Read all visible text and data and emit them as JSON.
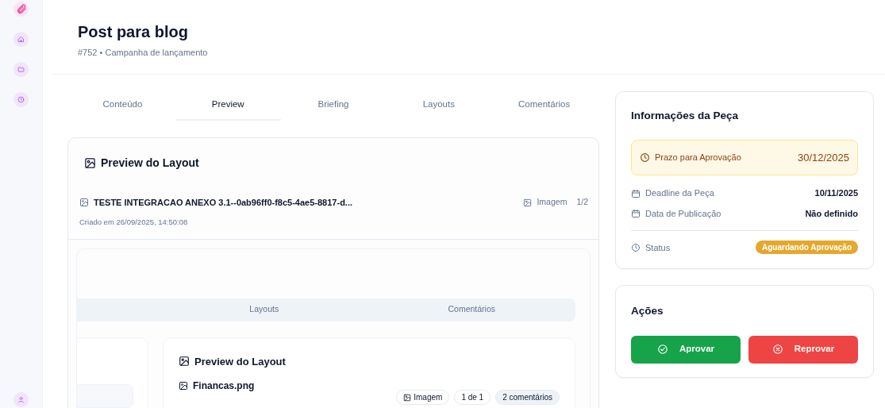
{
  "header": {
    "title": "Post para blog",
    "subtitle": "#752 • Campanha de lançamento"
  },
  "tabs": [
    {
      "label": "Conteúdo",
      "selected": false
    },
    {
      "label": "Preview",
      "selected": true
    },
    {
      "label": "Briefing",
      "selected": false
    },
    {
      "label": "Layouts",
      "selected": false
    },
    {
      "label": "Comentários",
      "selected": false
    }
  ],
  "preview": {
    "title": "Preview do Layout",
    "file_name": "TESTE INTEGRACAO ANEXO 3.1--0ab96ff0-f8c5-4ae5-8817-d...",
    "file_type": "Imagem",
    "page": "1/2",
    "created": "Criado em 26/09/2025, 14:50:08",
    "embedded": {
      "tabs": [
        "Layouts",
        "Comentários"
      ],
      "card_title": "Preview do Layout",
      "file_name": "Financas.png",
      "badges": [
        "Imagem",
        "1 de 1",
        "2 comentários"
      ]
    }
  },
  "info": {
    "title": "Informações da Peça",
    "highlight": {
      "label": "Prazo para Aprovação",
      "value": "30/12/2025"
    },
    "rows": [
      {
        "label": "Deadline da Peça",
        "value": "10/11/2025"
      },
      {
        "label": "Data de Publicação",
        "value": "Não definido"
      }
    ],
    "status": {
      "label": "Status",
      "value": "Aguardando Aprovação"
    }
  },
  "actions": {
    "title": "Ações",
    "buttons": [
      {
        "label": "Aprovar",
        "kind": "approve"
      },
      {
        "label": "Reprovar",
        "kind": "reject"
      }
    ]
  }
}
